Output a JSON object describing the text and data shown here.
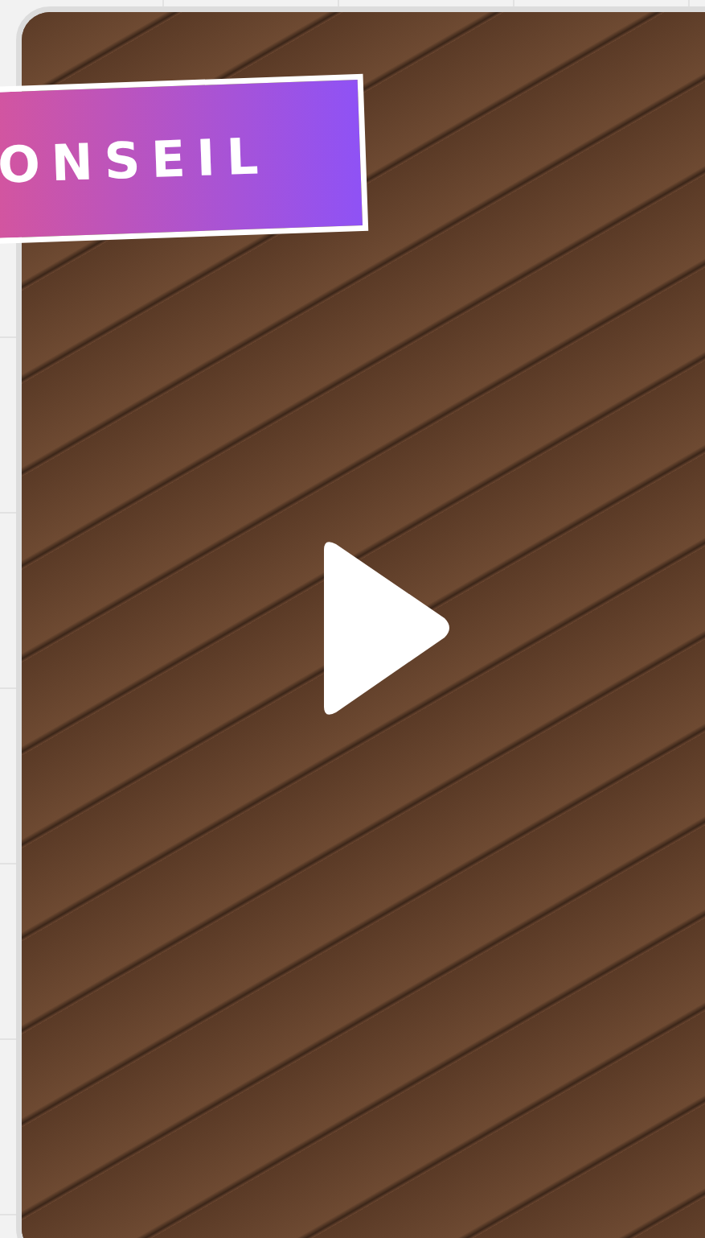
{
  "video": {
    "banner": "ONSEIL"
  }
}
